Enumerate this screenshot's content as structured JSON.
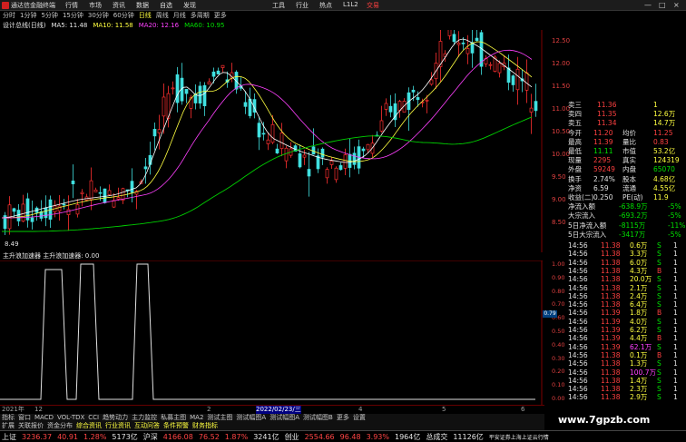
{
  "menubar": {
    "app_name": "通达信金融终端",
    "menus": [
      "行情",
      "市场",
      "资讯",
      "数据",
      "自选",
      "发现"
    ],
    "center_menus": [
      "工具",
      "行业",
      "热点",
      "L1L2"
    ],
    "trade": "交易",
    "window_buttons": [
      "—",
      "□",
      "×"
    ]
  },
  "periods": [
    "分时",
    "1分钟",
    "5分钟",
    "15分钟",
    "30分钟",
    "60分钟",
    "日线",
    "周线",
    "月线",
    "多周期",
    "更多"
  ],
  "active_period": "日线",
  "indicators": {
    "name": "设计总线(日线)",
    "ma5": "MA5: 11.48",
    "ma10": "MA10: 11.58",
    "ma20": "MA20: 12.16",
    "ma60": "MA60: 10.95"
  },
  "y_axis": [
    "12.50",
    "12.00",
    "11.50",
    "11.00",
    "10.50",
    "10.00",
    "9.50",
    "9.00",
    "8.50"
  ],
  "chart_labels": {
    "low_label": "8.49"
  },
  "sub_indicator": {
    "title": "主升浪加速器  主升浪加速器: 0.00",
    "y_axis": [
      "1.00",
      "0.90",
      "0.80",
      "0.70",
      "0.60",
      "0.50",
      "0.40",
      "0.30",
      "0.20",
      "0.10",
      "0.00"
    ],
    "marker": "0.79"
  },
  "dates": [
    "2021年",
    "12",
    "2",
    "2022/02/23/三",
    "4",
    "5",
    "6"
  ],
  "tabs": [
    "指标",
    "窗口",
    "MACD",
    "VOL-TDX",
    "CCI",
    "趋势动力",
    "主力监控",
    "私募主图",
    "MA2",
    "测试主图",
    "测试幅图A",
    "测试幅图A",
    "测试幅图B",
    "更多",
    "设置"
  ],
  "tabs2": [
    "扩展",
    "关联报价",
    "资金分布",
    "综合资讯",
    "行业资讯",
    "互动问答",
    "条件预警",
    "财务指标"
  ],
  "quote_panel": {
    "rows": [
      {
        "l": "卖三",
        "v": "11.36",
        "r": "1"
      },
      {
        "l": "卖四",
        "v": "11.35",
        "r": "12.6万"
      },
      {
        "l": "卖五",
        "v": "11.34",
        "r": "14.7万"
      },
      {
        "l": "今开",
        "v": "11.20",
        "l2": "均价",
        "v2": "11.25"
      },
      {
        "l": "最高",
        "v": "11.39",
        "l2": "量比",
        "v2": "0.83"
      },
      {
        "l": "最低",
        "v": "11.11",
        "l2": "市值",
        "v2": "53.2亿"
      },
      {
        "l": "现量",
        "v": "2295",
        "l2": "真实",
        "v2": "124319"
      },
      {
        "l": "外盘",
        "v": "59249",
        "l2": "内盘",
        "v2": "65070"
      },
      {
        "l": "换手",
        "v": "2.74%",
        "l2": "股本",
        "v2": "4.68亿"
      },
      {
        "l": "净资",
        "v": "6.59",
        "l2": "流通",
        "v2": "4.55亿"
      },
      {
        "l": "收益(二)",
        "v": "0.250",
        "l2": "PE(动)",
        "v2": "11.9"
      },
      {
        "l": "净流入额",
        "v": "-638.9万",
        "v2": "-5%"
      },
      {
        "l": "大宗流入",
        "v": "-693.2万",
        "v2": "-5%"
      },
      {
        "l": "5日净流入额",
        "v": "-8115万",
        "v2": "-11%"
      },
      {
        "l": "5日大宗流入",
        "v": "-3417万",
        "v2": "-5%"
      }
    ]
  },
  "ticks": [
    {
      "t": "14:56",
      "p": "11.38",
      "v": "0.6万",
      "d": "S",
      "n": "1"
    },
    {
      "t": "14:56",
      "p": "11.38",
      "v": "3.3万",
      "d": "S",
      "n": "1"
    },
    {
      "t": "14:56",
      "p": "11.38",
      "v": "6.0万",
      "d": "S",
      "n": "1"
    },
    {
      "t": "14:56",
      "p": "11.38",
      "v": "4.3万",
      "d": "B",
      "n": "1"
    },
    {
      "t": "14:56",
      "p": "11.38",
      "v": "20.0万",
      "d": "S",
      "n": "1"
    },
    {
      "t": "14:56",
      "p": "11.38",
      "v": "2.1万",
      "d": "S",
      "n": "1"
    },
    {
      "t": "14:56",
      "p": "11.38",
      "v": "2.4万",
      "d": "S",
      "n": "1"
    },
    {
      "t": "14:56",
      "p": "11.38",
      "v": "6.4万",
      "d": "S",
      "n": "1"
    },
    {
      "t": "14:56",
      "p": "11.39",
      "v": "1.8万",
      "d": "B",
      "n": "1"
    },
    {
      "t": "14:56",
      "p": "11.39",
      "v": "4.0万",
      "d": "S",
      "n": "1"
    },
    {
      "t": "14:56",
      "p": "11.39",
      "v": "6.2万",
      "d": "S",
      "n": "1"
    },
    {
      "t": "14:56",
      "p": "11.39",
      "v": "4.4万",
      "d": "B",
      "n": "1"
    },
    {
      "t": "14:56",
      "p": "11.39",
      "v": "62.1万",
      "d": "S",
      "n": "1"
    },
    {
      "t": "14:56",
      "p": "11.38",
      "v": "0.1万",
      "d": "B",
      "n": "1"
    },
    {
      "t": "14:56",
      "p": "11.38",
      "v": "1.3万",
      "d": "S",
      "n": "1"
    },
    {
      "t": "14:56",
      "p": "11.38",
      "v": "100.7万",
      "d": "S",
      "n": "1"
    },
    {
      "t": "14:56",
      "p": "11.38",
      "v": "1.4万",
      "d": "S",
      "n": "1"
    },
    {
      "t": "14:56",
      "p": "11.38",
      "v": "2.3万",
      "d": "S",
      "n": "1"
    },
    {
      "t": "14:56",
      "p": "11.38",
      "v": "2.9万",
      "d": "S",
      "n": "1"
    }
  ],
  "status": {
    "sh_label": "上证",
    "sh_value": "3236.37",
    "sh_change": "40.91",
    "sh_pct": "1.28%",
    "sh_amount": "5173亿",
    "hs_label": "沪深",
    "hs_value": "4166.08",
    "hs_change": "76.52",
    "hs_pct": "1.87%",
    "hs_amount": "3241亿",
    "cy_label": "创业",
    "cy_value": "2554.66",
    "cy_change": "96.48",
    "cy_pct": "3.93%",
    "cy_amount": "1964亿",
    "total_label": "总成交",
    "total_value": "11126亿",
    "extra": "平安证券上海上证云行情"
  },
  "watermark": "www.7gpzb.com"
}
